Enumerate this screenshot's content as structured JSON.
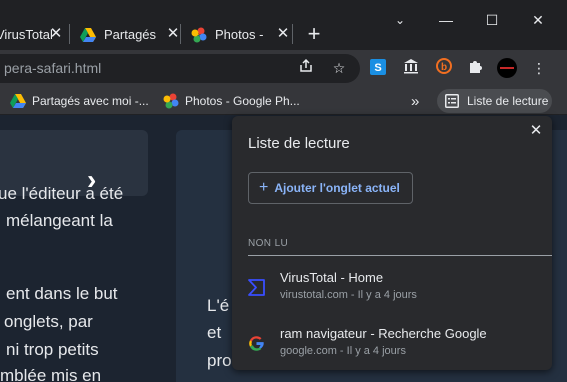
{
  "tabs": [
    {
      "title": "VirusTotal",
      "icon": "virustotal-icon"
    },
    {
      "title": "Partagés",
      "icon": "google-drive-icon"
    },
    {
      "title": "Photos -",
      "icon": "google-photos-icon"
    }
  ],
  "omnibox": {
    "url": "pera-safari.html"
  },
  "bookmarks": [
    {
      "label": "Partagés avec moi -...",
      "icon": "google-drive-icon"
    },
    {
      "label": "Photos - Google Ph...",
      "icon": "google-photos-icon"
    }
  ],
  "bookmarks_overflow": "»",
  "reading_list_button": {
    "label": "Liste de lecture"
  },
  "page": {
    "left_lines": [
      "ue l'éditeur a été",
      "mélangeant la",
      "ent dans le but",
      "onglets, par",
      "ni trop petits",
      "mblée mis en"
    ],
    "right_lines": [
      "L'é",
      "et",
      "pro"
    ]
  },
  "reading_list_panel": {
    "title": "Liste de lecture",
    "add_button": "Ajouter l'onglet actuel",
    "section_unread": "NON LU",
    "items": [
      {
        "title": "VirusTotal - Home",
        "meta": "virustotal.com - Il y a 4 jours",
        "icon": "virustotal-icon"
      },
      {
        "title": "ram navigateur - Recherche Google",
        "meta": "google.com - Il y a 4 jours",
        "icon": "google-icon"
      }
    ]
  },
  "colors": {
    "tab_strip": "#202124",
    "toolbar": "#35363a",
    "panel": "#292a2d",
    "accent_blue": "#8ab4f8",
    "page_bg": "#1c2430"
  }
}
